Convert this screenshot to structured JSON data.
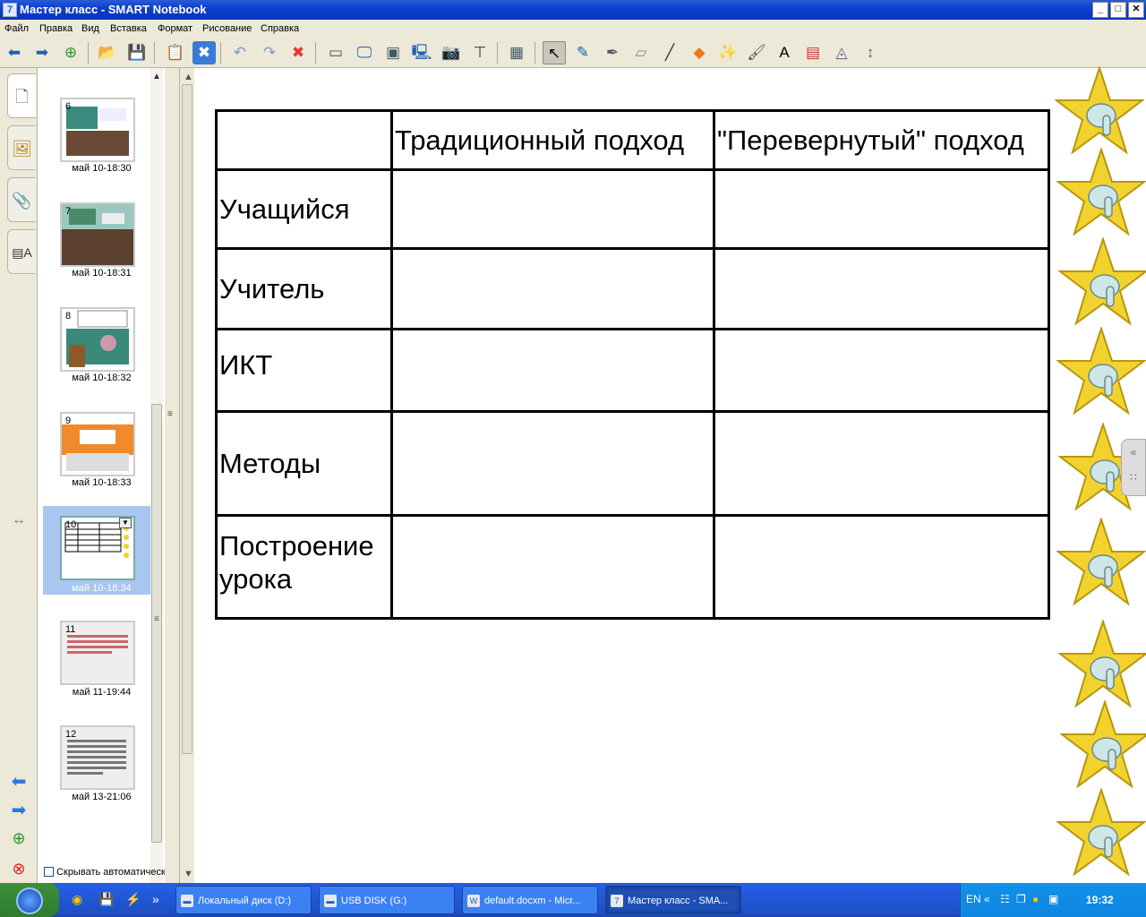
{
  "window": {
    "title": "Мастер класс - SMART Notebook",
    "buttons": [
      "_",
      "□",
      "✕"
    ]
  },
  "menu": [
    "Файл",
    "Правка",
    "Вид",
    "Вставка",
    "Формат",
    "Рисование",
    "Справка"
  ],
  "toolbar": {
    "icons": [
      "back-icon",
      "forward-icon",
      "new-page-icon",
      "open-icon",
      "save-icon",
      "paste-icon",
      "delete-page-icon",
      "undo-icon",
      "redo-icon",
      "delete-icon",
      "screen-shade-icon",
      "full-screen-icon",
      "dual-page-icon",
      "capture-toolbar-icon",
      "document-camera-icon",
      "insert-table-icon",
      "table-icon",
      "select-icon",
      "pen-icon",
      "creative-pen-icon",
      "eraser-icon",
      "line-icon",
      "shapes-icon",
      "magic-pen-icon",
      "fill-icon",
      "text-icon",
      "properties-icon",
      "measurement-icon",
      "move-toolbar-icon"
    ]
  },
  "sidebar": {
    "tabs": [
      "page-sorter-icon",
      "gallery-icon",
      "attachments-icon",
      "properties-icon"
    ]
  },
  "sorter": {
    "pages": [
      {
        "num": "6",
        "caption": "май 10-18:30"
      },
      {
        "num": "7",
        "caption": "май 10-18:31"
      },
      {
        "num": "8",
        "caption": "май 10-18:32"
      },
      {
        "num": "9",
        "caption": "май 10-18:33"
      },
      {
        "num": "10",
        "caption": "май 10-18:34"
      },
      {
        "num": "11",
        "caption": "май 11-19:44"
      },
      {
        "num": "12",
        "caption": "май 13-21:06"
      }
    ],
    "selected_page": "10",
    "autohide_label": "Скрывать автоматическ"
  },
  "table": {
    "headers": [
      "",
      "Традиционный подход",
      "\"Перевернутый\" подход"
    ],
    "rows": [
      {
        "label": "Учащийся",
        "c1": "",
        "c2": ""
      },
      {
        "label": "Учитель",
        "c1": "",
        "c2": ""
      },
      {
        "label": "ИКТ",
        "c1": "",
        "c2": ""
      },
      {
        "label": "Методы",
        "c1": "",
        "c2": ""
      },
      {
        "label": "Построение урока",
        "c1": "",
        "c2": ""
      }
    ]
  },
  "stars": {
    "count": 9,
    "icon": "star-pointing-hand-icon"
  },
  "taskbar": {
    "tasks": [
      {
        "label": "Локальный диск (D:)"
      },
      {
        "label": "USB DISK (G:)"
      },
      {
        "label": "default.docxm - Micr..."
      },
      {
        "label": "Мастер класс - SMA..."
      }
    ],
    "tray_lang": "EN",
    "clock": "19:32"
  },
  "colors": {
    "title": "#0b3fcf",
    "selection": "#a8c6ef",
    "star": "#f2d22e",
    "taskbar": "#245ee6"
  }
}
